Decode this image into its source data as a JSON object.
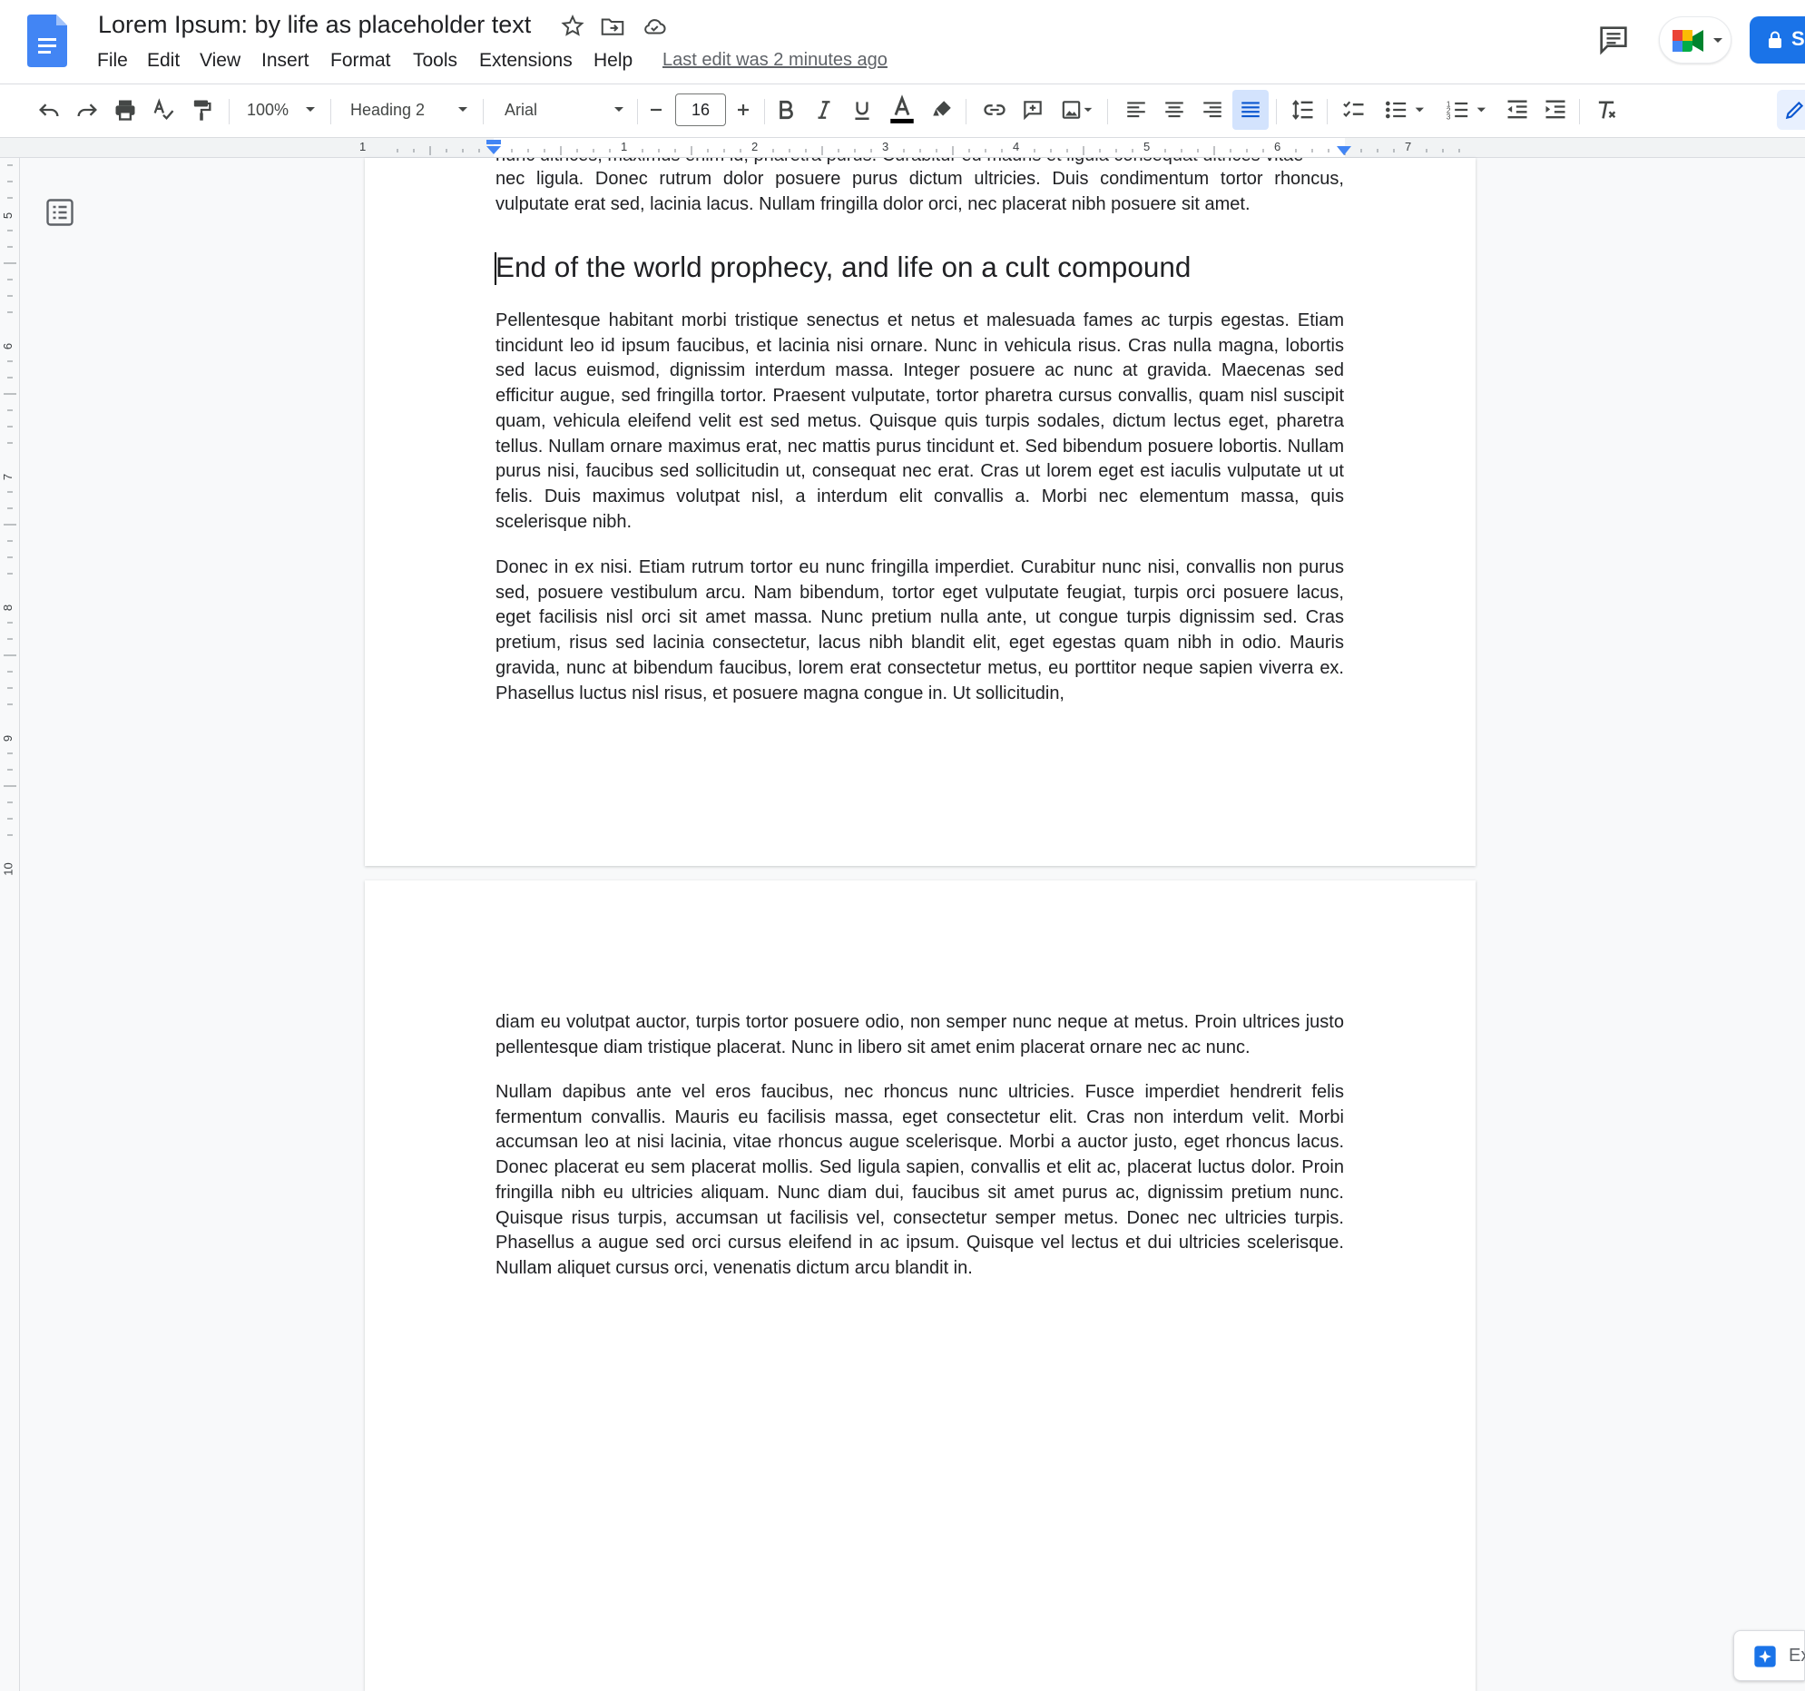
{
  "doc": {
    "title": "Lorem Ipsum: by life as placeholder text",
    "last_edit": "Last edit was 2 minutes ago"
  },
  "menu": {
    "items": [
      "File",
      "Edit",
      "View",
      "Insert",
      "Format",
      "Tools",
      "Extensions",
      "Help"
    ]
  },
  "toolbar": {
    "zoom": "100%",
    "style": "Heading 2",
    "font": "Arial",
    "font_size": "16",
    "share_label": "S"
  },
  "ruler": {
    "h_ticks": [
      "1",
      "1",
      "2",
      "3",
      "4",
      "5",
      "6",
      "7"
    ],
    "v_ticks": [
      "5",
      "6",
      "7",
      "8",
      "9",
      "10"
    ]
  },
  "content": {
    "para_top_cut": "nunc ultrices, maximus enim id, pharetra purus. Curabitur eu mauris et ligula consequat ultrices vitae",
    "para_top_1": "nec ligula. Donec rutrum dolor posuere purus dictum ultricies. Duis condimentum tortor rhoncus,",
    "para_top_2": "vulputate erat sed, lacinia lacus. Nullam fringilla dolor orci, nec placerat nibh posuere sit amet.",
    "heading": "End of the world prophecy, and life on a cult compound",
    "para1": "Pellentesque habitant morbi tristique senectus et netus et malesuada fames ac turpis egestas. Etiam tincidunt leo id ipsum faucibus, et lacinia nisi ornare. Nunc in vehicula risus. Cras nulla magna, lobortis sed lacus euismod, dignissim interdum massa. Integer posuere ac nunc at gravida. Maecenas sed efficitur augue, sed fringilla tortor. Praesent vulputate, tortor pharetra cursus convallis, quam nisl suscipit quam, vehicula eleifend velit est sed metus. Quisque quis turpis sodales, dictum lectus eget, pharetra tellus. Nullam ornare maximus erat, nec mattis purus tincidunt et. Sed bibendum posuere lobortis. Nullam purus nisi, faucibus sed sollicitudin ut, consequat nec erat. Cras ut lorem eget est iaculis vulputate ut ut felis. Duis maximus volutpat nisl, a interdum elit convallis a. Morbi nec elementum massa, quis scelerisque nibh.",
    "para2": "Donec in ex nisi. Etiam rutrum tortor eu nunc fringilla imperdiet. Curabitur nunc nisi, convallis non purus sed, posuere vestibulum arcu. Nam bibendum, tortor eget vulputate feugiat, turpis orci posuere lacus, eget facilisis nisl orci sit amet massa. Nunc pretium nulla ante, ut congue turpis dignissim sed. Cras pretium, risus sed lacinia consectetur, lacus nibh blandit elit, eget egestas quam nibh in odio. Mauris gravida, nunc at bibendum faucibus, lorem erat consectetur metus, eu porttitor neque sapien viverra ex. Phasellus luctus nisl risus, et posuere magna congue in. Ut sollicitudin,",
    "para3": "diam eu volutpat auctor, turpis tortor posuere odio, non semper nunc neque at metus. Proin ultrices justo pellentesque diam tristique placerat. Nunc in libero sit amet enim placerat ornare nec ac nunc.",
    "para4": "Nullam dapibus ante vel eros faucibus, nec rhoncus nunc ultricies. Fusce imperdiet hendrerit felis fermentum convallis. Mauris eu facilisis massa, eget consectetur elit. Cras non interdum velit. Morbi accumsan leo at nisi lacinia, vitae rhoncus augue scelerisque. Morbi a auctor justo, eget rhoncus lacus. Donec placerat eu sem placerat mollis. Sed ligula sapien, convallis et elit ac, placerat luctus dolor. Proin fringilla nibh eu ultricies aliquam. Nunc diam dui, faucibus sit amet purus ac, dignissim pretium nunc. Quisque risus turpis, accumsan ut facilisis vel, consectetur semper metus. Donec nec ultricies turpis. Phasellus a augue sed orci cursus eleifend in ac ipsum. Quisque vel lectus et dui ultricies scelerisque. Nullam aliquet cursus orci, venenatis dictum arcu blandit in."
  },
  "explore": {
    "label": "Ex"
  },
  "colors": {
    "accent": "#1a73e8",
    "docs_blue": "#4285f4"
  }
}
